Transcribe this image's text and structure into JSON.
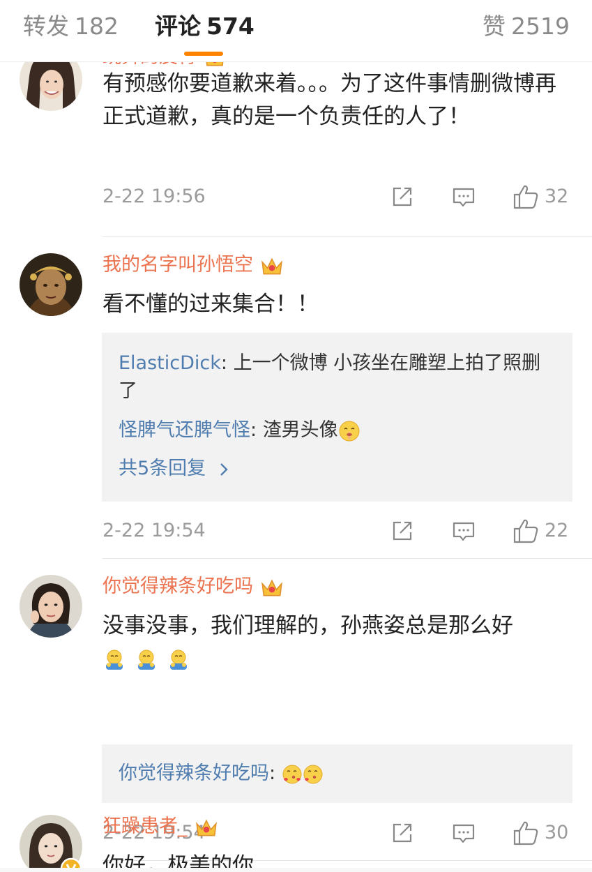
{
  "tabs": {
    "repost": {
      "label": "转发",
      "count": "182"
    },
    "comment": {
      "label": "评论",
      "count": "574"
    },
    "like": {
      "label": "赞",
      "count": "2519"
    }
  },
  "comments": [
    {
      "user": "跳舞的皮青",
      "text": "有预感你要道歉来着。。。为了这件事情删微博再正式道歉，真的是一个负责任的人了！",
      "time": "2-22 19:56",
      "likes": "32"
    },
    {
      "user": "我的名字叫孙悟空",
      "text": "看不懂的过来集合！！",
      "replies": [
        {
          "user": "ElasticDick",
          "text": "上一个微博 小孩坐在雕塑上拍了照删了"
        },
        {
          "user": "怪脾气还脾气怪",
          "text": "渣男头像"
        }
      ],
      "more_replies": "共5条回复",
      "time": "2-22 19:54",
      "likes": "22"
    },
    {
      "user": "你觉得辣条好吃吗",
      "text": "没事没事，我们理解的，孙燕姿总是那么好",
      "replies": [
        {
          "user": "你觉得辣条好吃吗",
          "text": ""
        }
      ],
      "time": "2-22 19:54",
      "likes": "30"
    },
    {
      "user": "狂躁患者_",
      "text": "你好，极美的你"
    }
  ],
  "colors": {
    "accent": "#ff8200",
    "username": "#eb7350",
    "link": "#507daf",
    "meta": "#9b9b9b"
  },
  "icons": [
    "crown-icon",
    "repost-icon",
    "comment-icon",
    "like-icon",
    "chevron-right-icon",
    "verified-badge-icon"
  ]
}
